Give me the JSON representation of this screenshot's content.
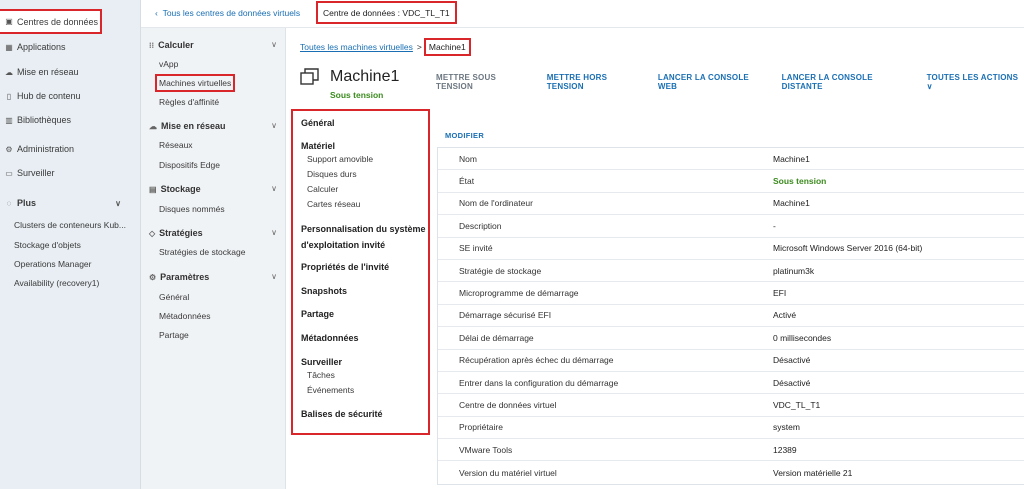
{
  "left_nav": {
    "items": [
      {
        "label": "Centres de données",
        "icon": "datacenter-icon"
      },
      {
        "label": "Applications",
        "icon": "apps-icon"
      },
      {
        "label": "Mise en réseau",
        "icon": "network-icon"
      },
      {
        "label": "Hub de contenu",
        "icon": "content-hub-icon"
      },
      {
        "label": "Bibliothèques",
        "icon": "library-icon"
      },
      {
        "label": "Administration",
        "icon": "gear-icon"
      },
      {
        "label": "Surveiller",
        "icon": "monitor-icon"
      },
      {
        "label": "Plus",
        "icon": "plus-icon"
      }
    ],
    "plus_items": [
      "Clusters de conteneurs Kub...",
      "Stockage d'objets",
      "Operations Manager",
      "Availability (recovery1)"
    ]
  },
  "topbar": {
    "back_link": "Tous les centres de données virtuels",
    "datacenter_label": "Centre de données :",
    "datacenter_name": "VDC_TL_T1"
  },
  "col2": {
    "calculer": {
      "title": "Calculer",
      "items": [
        "vApp",
        "Machines virtuelles",
        "Règles d'affinité"
      ]
    },
    "reseau": {
      "title": "Mise en réseau",
      "items": [
        "Réseaux",
        "Dispositifs Edge"
      ]
    },
    "stockage": {
      "title": "Stockage",
      "items": [
        "Disques nommés"
      ]
    },
    "strategies": {
      "title": "Stratégies",
      "items": [
        "Stratégies de stockage"
      ]
    },
    "parametres": {
      "title": "Paramètres",
      "items": [
        "Général",
        "Métadonnées",
        "Partage"
      ]
    }
  },
  "breadcrumb": {
    "parent": "Toutes les machines virtuelles",
    "separator": ">",
    "current": "Machine1"
  },
  "vm": {
    "name": "Machine1",
    "state": "Sous tension",
    "actions": [
      "METTRE SOUS TENSION",
      "METTRE HORS TENSION",
      "LANCER LA CONSOLE WEB",
      "LANCER LA CONSOLE DISTANTE",
      "TOUTES LES ACTIONS"
    ]
  },
  "sections": {
    "general": "Général",
    "materiel": "Matériel",
    "materiel_items": [
      "Support amovible",
      "Disques durs",
      "Calculer",
      "Cartes réseau"
    ],
    "perso_1": "Personnalisation du système",
    "perso_2": "d'exploitation invité",
    "proprietes": "Propriétés de l'invité",
    "snapshots": "Snapshots",
    "partage": "Partage",
    "metadonnees": "Métadonnées",
    "surveiller": "Surveiller",
    "surveiller_items": [
      "Tâches",
      "Événements"
    ],
    "balises": "Balises de sécurité"
  },
  "details": {
    "modify_label": "MODIFIER",
    "rows": [
      {
        "key": "Nom",
        "value": "Machine1"
      },
      {
        "key": "État",
        "value": "Sous tension"
      },
      {
        "key": "Nom de l'ordinateur",
        "value": "Machine1"
      },
      {
        "key": "Description",
        "value": "-"
      },
      {
        "key": "SE invité",
        "value": "Microsoft Windows Server 2016 (64-bit)"
      },
      {
        "key": "Stratégie de stockage",
        "value": "platinum3k"
      },
      {
        "key": "Microprogramme de démarrage",
        "value": "EFI"
      },
      {
        "key": "Démarrage sécurisé EFI",
        "value": "Activé"
      },
      {
        "key": "Délai de démarrage",
        "value": "0 millisecondes"
      },
      {
        "key": "Récupération après échec du démarrage",
        "value": "Désactivé"
      },
      {
        "key": "Entrer dans la configuration du démarrage",
        "value": "Désactivé"
      },
      {
        "key": "Centre de données virtuel",
        "value": "VDC_TL_T1"
      },
      {
        "key": "Propriétaire",
        "value": "system"
      },
      {
        "key": "VMware Tools",
        "value": "12389"
      },
      {
        "key": "Version du matériel virtuel",
        "value": "Version matérielle 21"
      }
    ]
  },
  "colors": {
    "accent": "#1a6fb4",
    "status_on": "#3b8b1e",
    "annotation": "#d9262b"
  }
}
